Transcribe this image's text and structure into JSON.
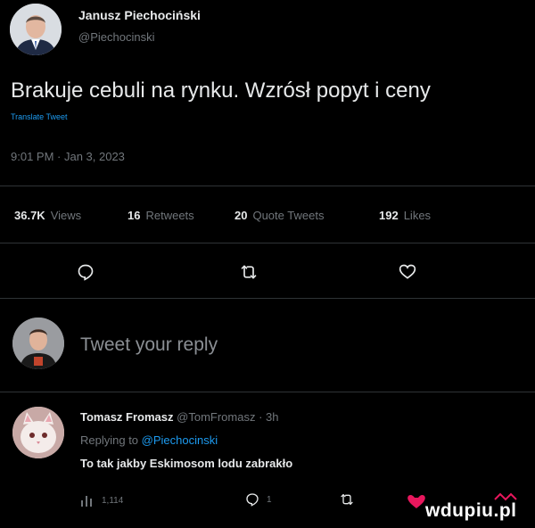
{
  "tweet": {
    "author_name": "Janusz Piechociński",
    "author_handle": "@Piechocinski",
    "text": "Brakuje cebuli na rynku. Wzrósł popyt i ceny",
    "translate_label": "Translate Tweet",
    "timestamp": "9:01 PM · Jan 3, 2023"
  },
  "stats": {
    "views_count": "36.7K",
    "views_label": "Views",
    "retweets_count": "16",
    "retweets_label": "Retweets",
    "quotes_count": "20",
    "quotes_label": "Quote Tweets",
    "likes_count": "192",
    "likes_label": "Likes"
  },
  "reply_box": {
    "placeholder": "Tweet your reply"
  },
  "reply": {
    "author_name": "Tomasz Fromasz",
    "author_handle": "@TomFromasz",
    "time": "· 3h",
    "replying_prefix": "Replying to",
    "replying_to": "@Piechocinski",
    "text": "To tak jakby Eskimosom lodu zabrakło",
    "views": "1,114",
    "replies": "1"
  },
  "watermark": "wdupiu.pl",
  "colors": {
    "background": "#000000",
    "accent": "#1d9bf0",
    "muted": "#71767b",
    "watermark_pink": "#e8175d"
  }
}
